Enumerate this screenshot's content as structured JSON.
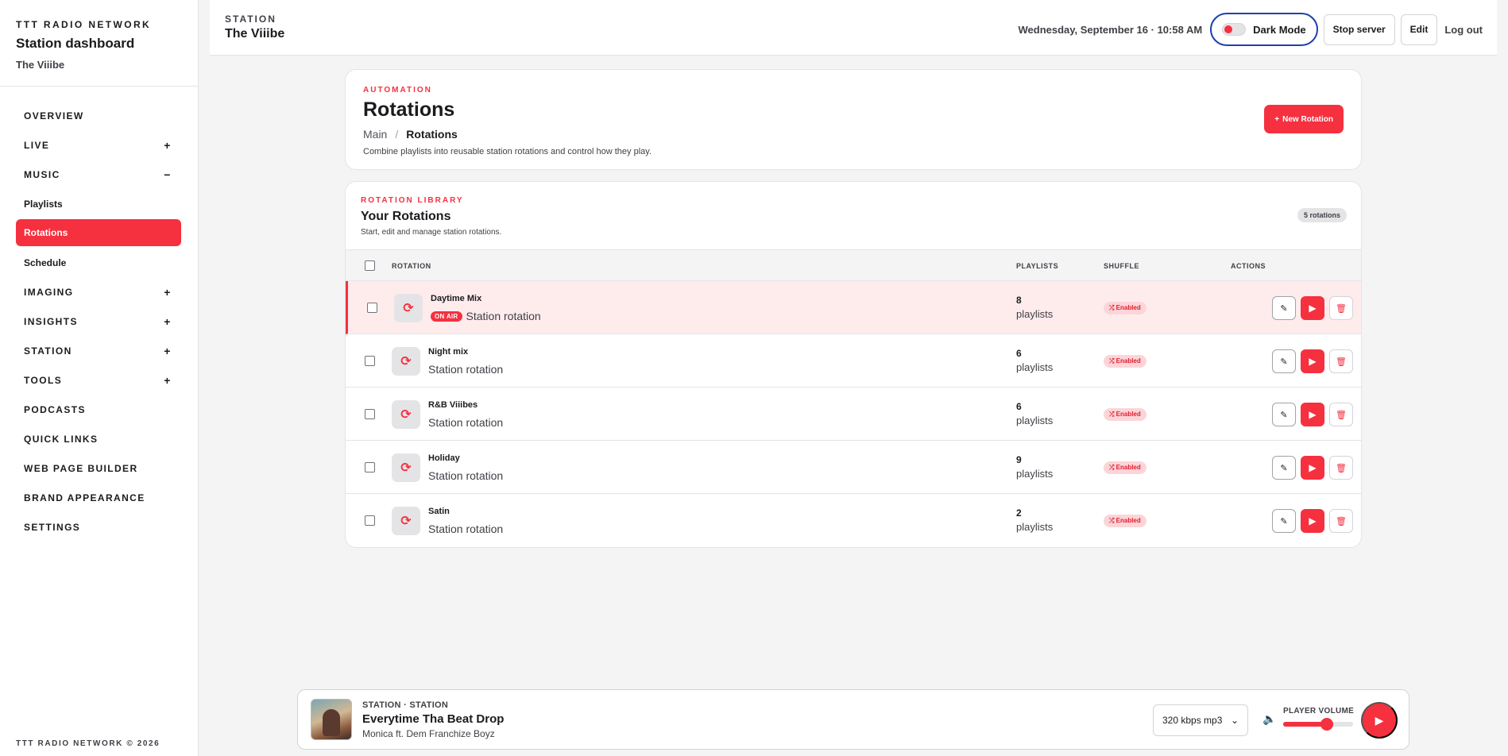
{
  "sidebar": {
    "network": "TTT RADIO NETWORK",
    "title": "Station dashboard",
    "station": "The Viiibe",
    "items": [
      {
        "label": "OVERVIEW",
        "toggle": ""
      },
      {
        "label": "LIVE",
        "toggle": "+"
      },
      {
        "label": "MUSIC",
        "toggle": "−"
      },
      {
        "label": "Playlists",
        "toggle": ""
      },
      {
        "label": "Rotations",
        "toggle": ""
      },
      {
        "label": "Schedule",
        "toggle": ""
      },
      {
        "label": "IMAGING",
        "toggle": "+"
      },
      {
        "label": "INSIGHTS",
        "toggle": "+"
      },
      {
        "label": "STATION",
        "toggle": "+"
      },
      {
        "label": "TOOLS",
        "toggle": "+"
      },
      {
        "label": "PODCASTS",
        "toggle": ""
      },
      {
        "label": "QUICK LINKS",
        "toggle": ""
      },
      {
        "label": "WEB PAGE BUILDER",
        "toggle": ""
      },
      {
        "label": "BRAND APPEARANCE",
        "toggle": ""
      },
      {
        "label": "SETTINGS",
        "toggle": ""
      }
    ],
    "footer": "TTT RADIO NETWORK © 2026"
  },
  "header": {
    "label": "STATION",
    "station": "The Viiibe",
    "datetime": "Wednesday, September 16 · 10:58 AM",
    "dark_mode": "Dark Mode",
    "stop_server": "Stop server",
    "edit": "Edit",
    "logout": "Log out"
  },
  "automation": {
    "eyebrow": "AUTOMATION",
    "title": "Rotations",
    "crumb_main": "Main",
    "crumb_sep": "/",
    "crumb_current": "Rotations",
    "description": "Combine playlists into reusable station rotations and control how they play.",
    "new_button": "New Rotation",
    "new_icon": "+"
  },
  "library": {
    "eyebrow": "ROTATION LIBRARY",
    "title": "Your Rotations",
    "subtitle": "Start, edit and manage station rotations.",
    "count": "5 rotations",
    "columns": {
      "rotation": "ROTATION",
      "playlists": "PLAYLISTS",
      "shuffle": "SHUFFLE",
      "actions": "ACTIONS"
    },
    "rows": [
      {
        "name": "Daytime Mix",
        "badge": "ON AIR",
        "type": "Station rotation",
        "count": "8",
        "unit": "playlists",
        "shuffle": "Enabled"
      },
      {
        "name": "Night mix",
        "badge": "",
        "type": "Station rotation",
        "count": "6",
        "unit": "playlists",
        "shuffle": "Enabled"
      },
      {
        "name": "R&B Viiibes",
        "badge": "",
        "type": "Station rotation",
        "count": "6",
        "unit": "playlists",
        "shuffle": "Enabled"
      },
      {
        "name": "Holiday",
        "badge": "",
        "type": "Station rotation",
        "count": "9",
        "unit": "playlists",
        "shuffle": "Enabled"
      },
      {
        "name": "Satin",
        "badge": "",
        "type": "Station rotation",
        "count": "2",
        "unit": "playlists",
        "shuffle": "Enabled"
      }
    ]
  },
  "player": {
    "label": "STATION · STATION",
    "title": "Everytime Tha Beat Drop",
    "artist": "Monica ft. Dem Franchize Boyz",
    "quality": "320 kbps mp3",
    "volume_label": "PLAYER VOLUME",
    "volume": 0.62
  },
  "icons": {
    "rotate": "rotate-icon",
    "shuffle": "shuffle-icon",
    "edit": "pencil-icon",
    "play": "play-icon",
    "delete": "trash-icon",
    "volume": "volume-icon"
  },
  "colors": {
    "accent": "#f5303f",
    "toggle_border": "#1e40af"
  }
}
